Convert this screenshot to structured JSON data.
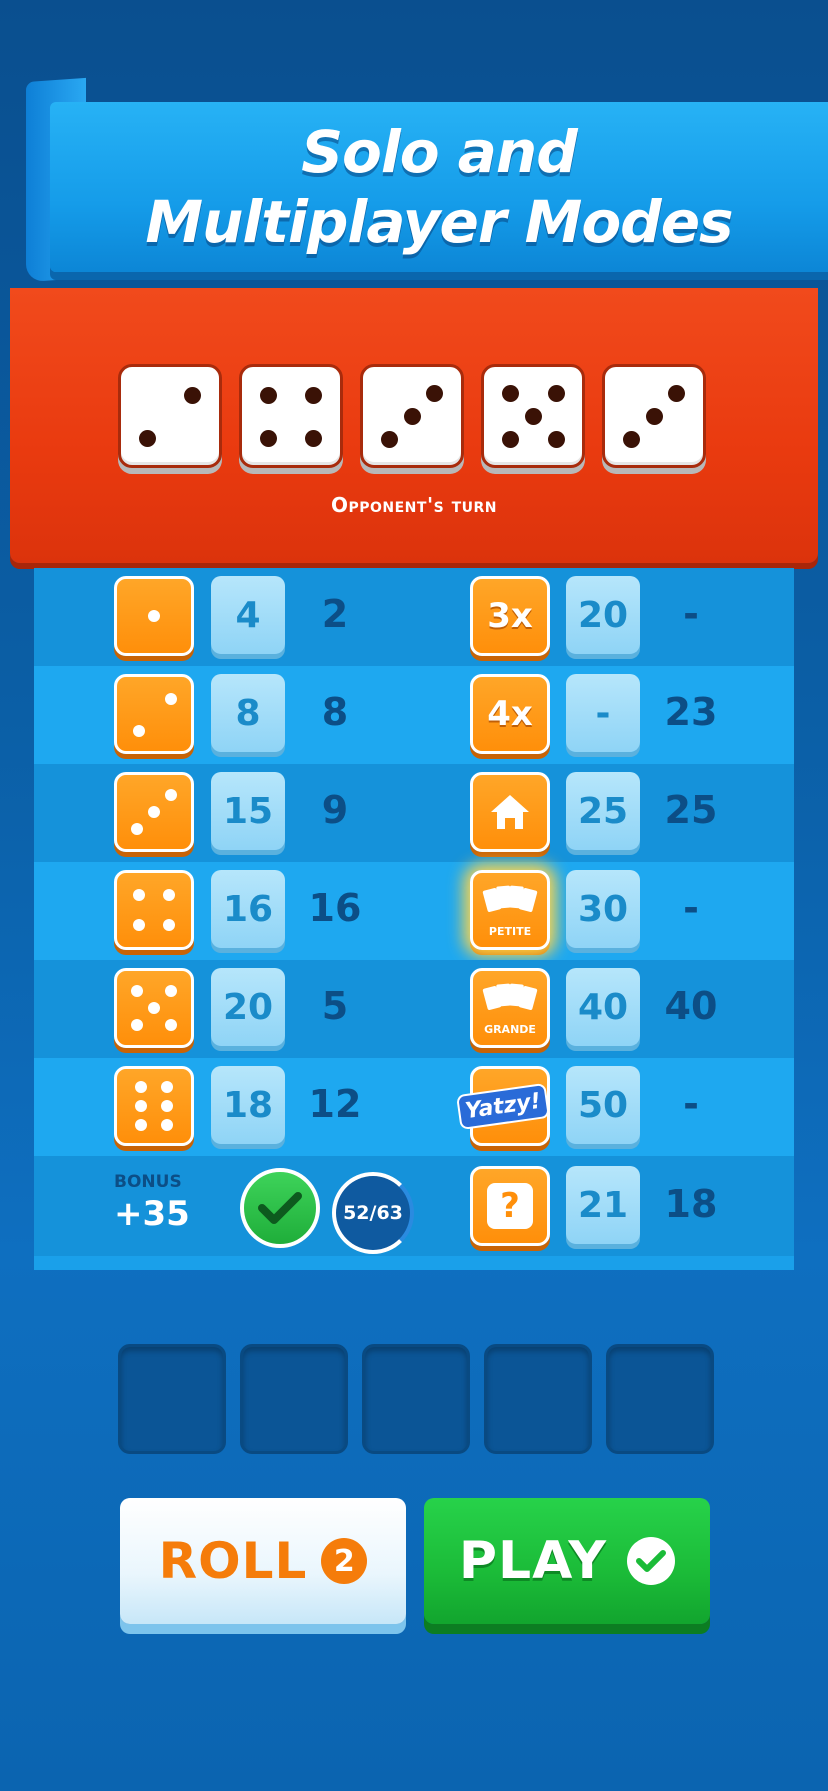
{
  "banner": {
    "line1": "Solo and",
    "line2": "Multiplayer Modes"
  },
  "opponent": {
    "dice": [
      2,
      4,
      3,
      5,
      3
    ],
    "turn_label": "Opponent's turn"
  },
  "upper_section": [
    {
      "icon": "die-face-1-icon",
      "player_score": "4",
      "opponent_score": "2"
    },
    {
      "icon": "die-face-2-icon",
      "player_score": "8",
      "opponent_score": "8"
    },
    {
      "icon": "die-face-3-icon",
      "player_score": "15",
      "opponent_score": "9"
    },
    {
      "icon": "die-face-4-icon",
      "player_score": "16",
      "opponent_score": "16"
    },
    {
      "icon": "die-face-5-icon",
      "player_score": "20",
      "opponent_score": "5"
    },
    {
      "icon": "die-face-6-icon",
      "player_score": "18",
      "opponent_score": "12"
    }
  ],
  "lower_section": [
    {
      "label": "3x",
      "player_score": "20",
      "opponent_score": "-"
    },
    {
      "label": "4x",
      "player_score": "-",
      "opponent_score": "23"
    },
    {
      "icon": "house-icon",
      "player_score": "25",
      "opponent_score": "25"
    },
    {
      "icon": "cards-icon",
      "label": "PETITE",
      "player_score": "30",
      "opponent_score": "-"
    },
    {
      "icon": "cards-icon",
      "label": "GRANDE",
      "player_score": "40",
      "opponent_score": "40"
    },
    {
      "label": "Yatzy!",
      "player_score": "50",
      "opponent_score": "-"
    },
    {
      "label": "?",
      "player_score": "21",
      "opponent_score": "18"
    }
  ],
  "bonus": {
    "label": "BONUS",
    "value": "+35",
    "progress_text": "52/63",
    "progress": 0.825
  },
  "buttons": {
    "roll_label": "ROLL",
    "roll_count": "2",
    "play_label": "PLAY"
  },
  "colors": {
    "orange": "#ff8f0a",
    "red_panel": "#e93a0f",
    "green": "#1bbb38",
    "blue_bg": "#0b5fa6"
  }
}
